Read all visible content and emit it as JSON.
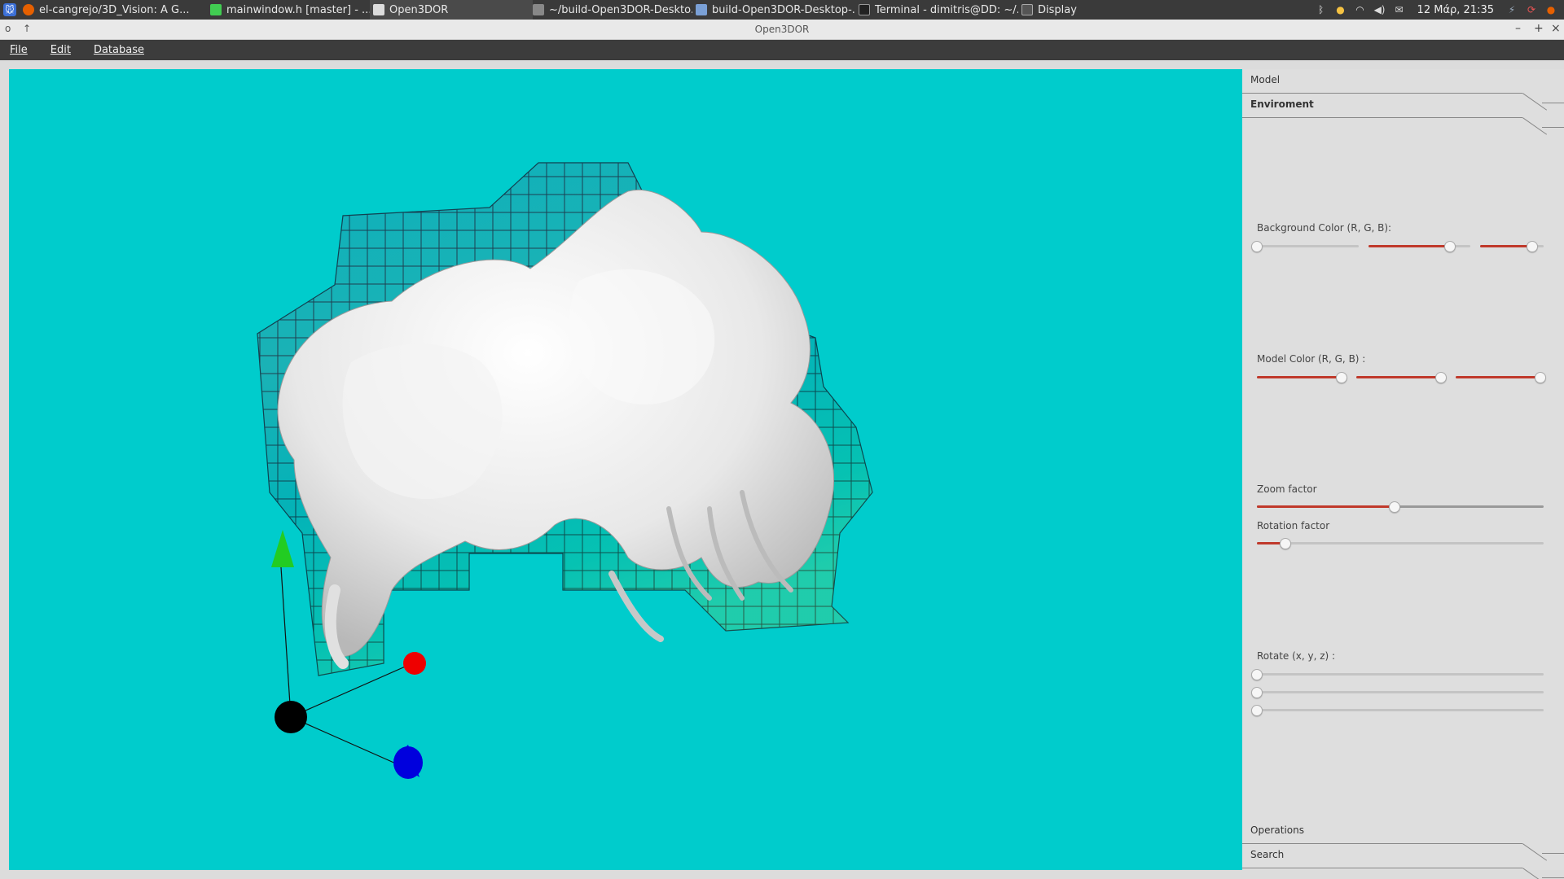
{
  "taskbar": {
    "tasks": [
      {
        "label": "el-cangrejo/3D_Vision: A G...",
        "icon": "firefox-icon",
        "color": "#e66000"
      },
      {
        "label": "mainwindow.h [master] - ...",
        "icon": "qtcreator-icon",
        "color": "#41cd52"
      },
      {
        "label": "Open3DOR",
        "icon": "window-icon",
        "color": "#dddddd"
      },
      {
        "label": "~/build-Open3DOR-Deskto...",
        "icon": "terminal-icon",
        "color": "#888888"
      },
      {
        "label": "build-Open3DOR-Desktop-...",
        "icon": "folder-icon",
        "color": "#7aa0d6"
      },
      {
        "label": "Terminal - dimitris@DD: ~/...",
        "icon": "terminal-icon",
        "color": "#222222"
      },
      {
        "label": "Display",
        "icon": "display-icon",
        "color": "#555555"
      }
    ],
    "clock": "12 Μάρ, 21:35"
  },
  "window": {
    "title": "Open3DOR"
  },
  "menu": {
    "items": [
      "File",
      "Edit",
      "Database"
    ]
  },
  "viewport": {
    "background": "#00cccc"
  },
  "panel": {
    "tabs": {
      "model": "Model",
      "environment": "Enviroment",
      "operations": "Operations",
      "search": "Search"
    },
    "background_color": {
      "label": "Background Color (R, G, B):",
      "values": [
        0.0,
        0.9,
        0.9
      ]
    },
    "model_color": {
      "label": "Model Color (R, G, B) :",
      "values": [
        0.8,
        0.8,
        0.8
      ]
    },
    "zoom": {
      "label": "Zoom factor",
      "value": 0.48
    },
    "rotation": {
      "label": "Rotation factor",
      "value": 0.1
    },
    "rotate": {
      "label": "Rotate (x, y, z) :",
      "values": [
        0,
        0,
        0
      ]
    },
    "accent": "#c0392b"
  }
}
